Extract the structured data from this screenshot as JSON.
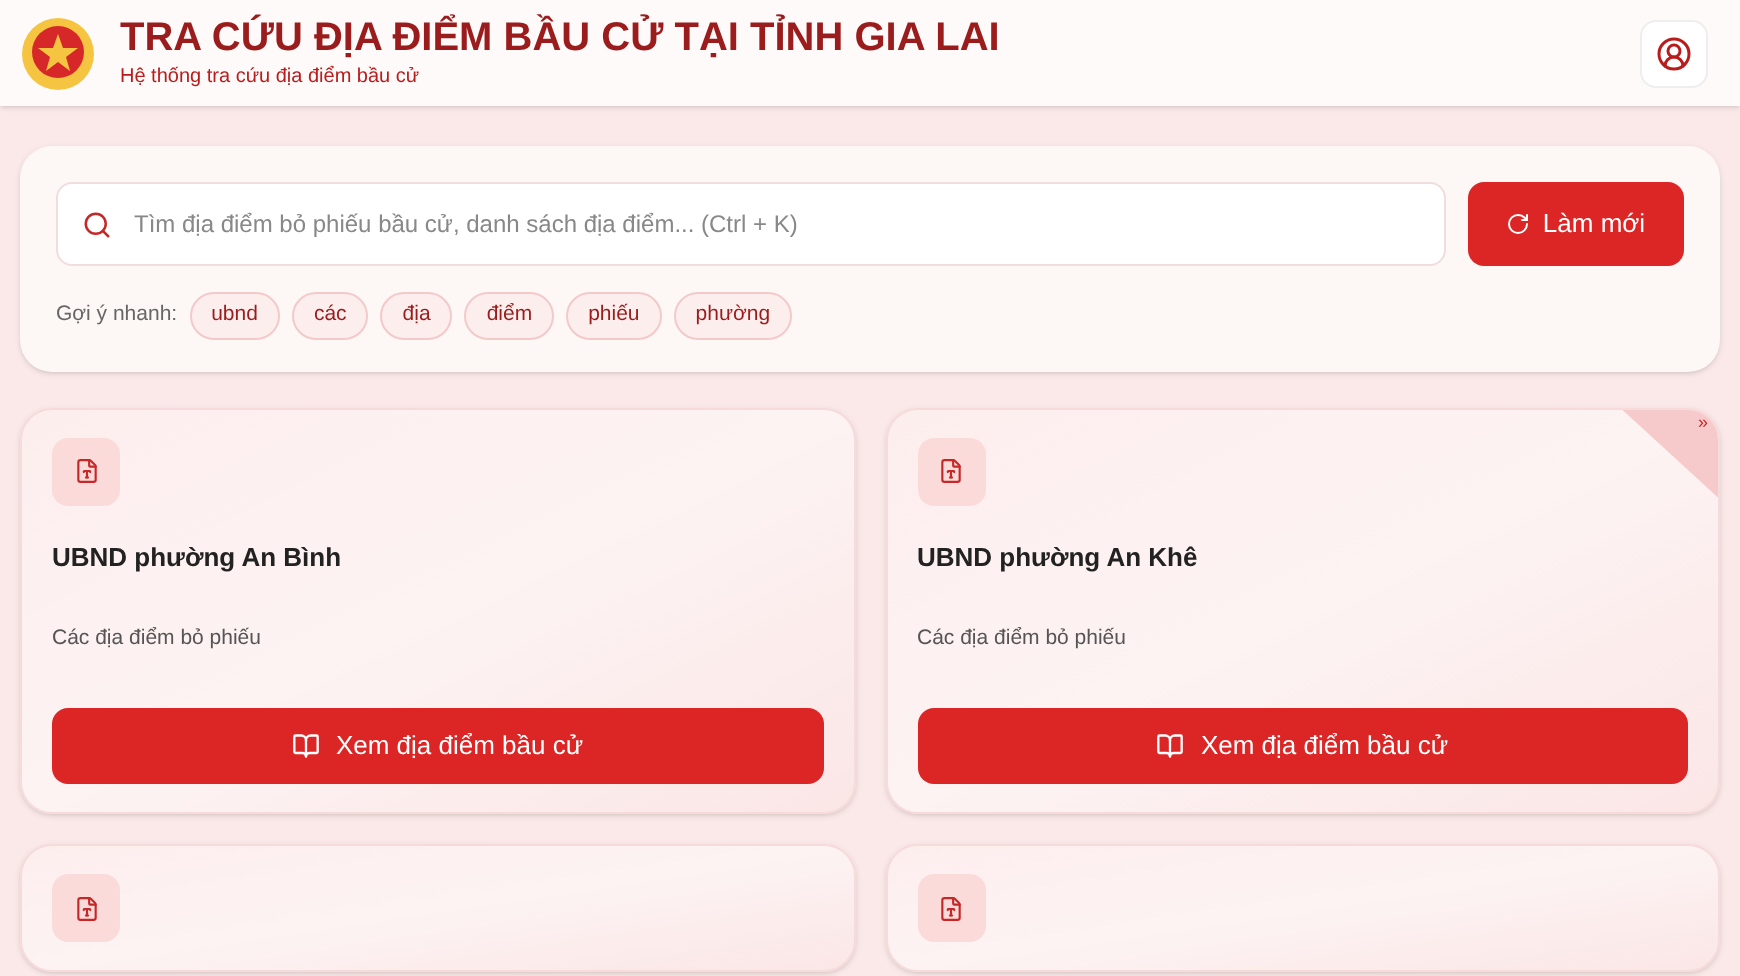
{
  "header": {
    "title": "TRA CỨU ĐỊA ĐIỂM BẦU CỬ TẠI TỈNH GIA LAI",
    "subtitle": "Hệ thống tra cứu địa điểm bầu cử"
  },
  "search": {
    "placeholder": "Tìm địa điểm bỏ phiếu bầu cử, danh sách địa điểm... (Ctrl + K)",
    "button": "Làm mới"
  },
  "suggestions": {
    "label": "Gợi ý nhanh:",
    "chips": [
      "ubnd",
      "các",
      "địa",
      "điểm",
      "phiếu",
      "phường"
    ]
  },
  "cards": [
    {
      "kind": "full",
      "title": "UBND phường An Bình",
      "description": "Các địa điểm bỏ phiếu",
      "button": "Xem địa điểm bầu cử"
    },
    {
      "kind": "full",
      "title": "UBND phường An Khê",
      "description": "Các địa điểm bỏ phiếu",
      "button": "Xem địa điểm bầu cử",
      "ribbon": "»"
    },
    {
      "kind": "icon_only"
    },
    {
      "kind": "icon_only"
    }
  ]
}
